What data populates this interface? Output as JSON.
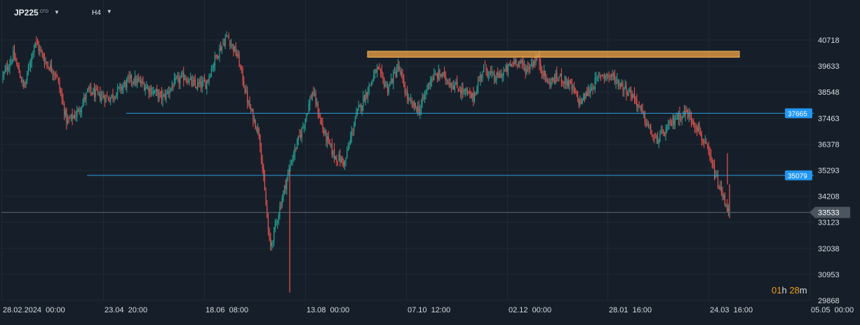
{
  "toolbar": {
    "symbol": "JP225",
    "symbol_tag": "CFD",
    "timeframe": "H4"
  },
  "countdown": {
    "hours": "01",
    "h_unit": "h",
    "minutes": "28",
    "m_unit": "m"
  },
  "colors": {
    "background": "#161f29",
    "up_candle": "#26a69a",
    "down_candle": "#ef5350",
    "level_line": "#2d9cdb",
    "resistance_zone": "#f2a444",
    "price_label_bg": "#4a5560"
  },
  "chart_data": {
    "type": "candlestick",
    "title": "",
    "xlabel": "",
    "ylabel": "",
    "ylim": [
      29500,
      41400
    ],
    "grid": true,
    "y_ticks": [
      40718,
      39633,
      38548,
      37463,
      36378,
      35293,
      34208,
      33123,
      32038,
      30953,
      29868
    ],
    "x_ticks": [
      "28.02.2024  00:00",
      "23.04  20:00",
      "18.06  08:00",
      "13.08  00:00",
      "07.10  12:00",
      "02.12  00:00",
      "28.01  16:00",
      "24.03  16:00",
      "05.05  00:00"
    ],
    "price_path": [
      39200,
      40100,
      38700,
      40700,
      39800,
      39300,
      37300,
      37700,
      38600,
      38400,
      38300,
      38700,
      39100,
      38900,
      38600,
      38300,
      38900,
      39200,
      38800,
      38900,
      40100,
      40900,
      40000,
      38000,
      36800,
      32000,
      33900,
      35700,
      37000,
      38600,
      36900,
      35900,
      35600,
      37500,
      38500,
      39500,
      38700,
      39600,
      38100,
      37800,
      39100,
      39300,
      38900,
      38600,
      38300,
      39600,
      39100,
      39400,
      39900,
      39500,
      40000,
      38900,
      39200,
      38900,
      38100,
      38700,
      39300,
      39200,
      38800,
      38400,
      37500,
      36500,
      36900,
      37500,
      37700,
      37100,
      36000,
      34600,
      33533
    ],
    "support_levels": [
      {
        "value": 37665,
        "label": "37665",
        "from": "13.05.2024",
        "to": "latest"
      },
      {
        "value": 35079,
        "label": "35079",
        "from": "28.03.2024",
        "to": "latest"
      }
    ],
    "resistance_zone": {
      "low": 40000,
      "high": 40250,
      "from": "05.09.2024",
      "to": "10.04.2025"
    },
    "current_price": {
      "value": 33533,
      "label": "33533"
    }
  }
}
